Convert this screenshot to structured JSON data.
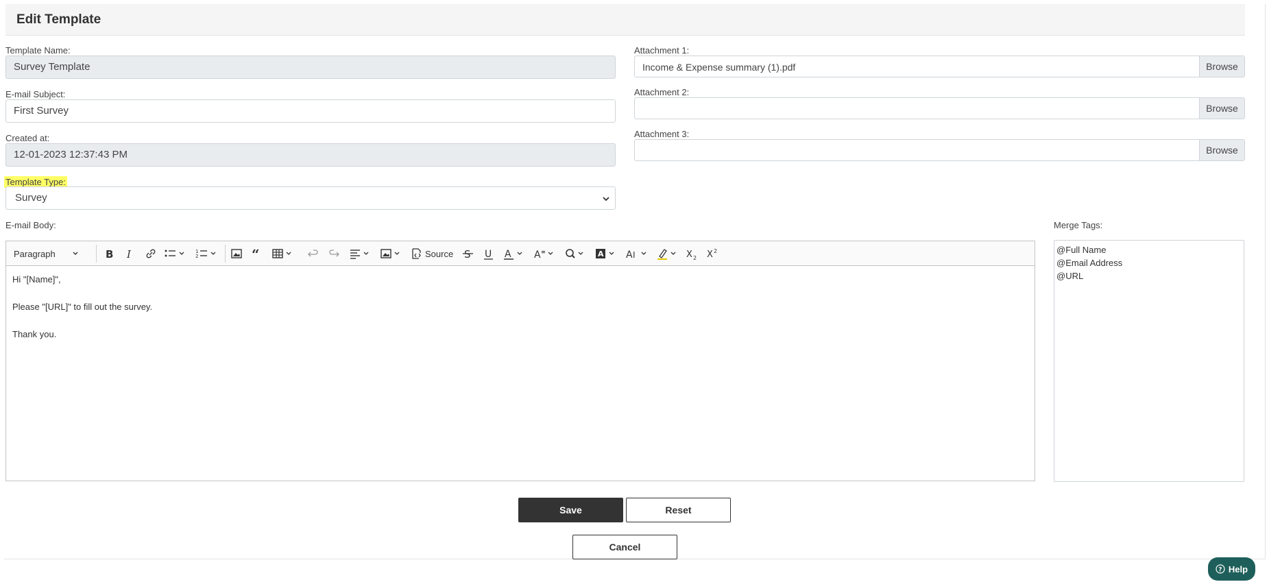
{
  "page": {
    "title": "Edit Template"
  },
  "form": {
    "template_name": {
      "label": "Template Name:",
      "value": "Survey Template"
    },
    "email_subject": {
      "label": "E-mail Subject:",
      "value": "First Survey"
    },
    "created_at": {
      "label": "Created at:",
      "value": "12-01-2023 12:37:43 PM"
    },
    "template_type": {
      "label": "Template Type:",
      "value": "Survey"
    },
    "email_body": {
      "label": "E-mail Body:"
    },
    "attachments": [
      {
        "label": "Attachment 1:",
        "file": "Income & Expense summary (1).pdf",
        "browse": "Browse"
      },
      {
        "label": "Attachment 2:",
        "file": "",
        "browse": "Browse"
      },
      {
        "label": "Attachment 3:",
        "file": "",
        "browse": "Browse"
      }
    ]
  },
  "editor": {
    "toolbar": {
      "heading": "Paragraph",
      "source": "Source"
    },
    "content": [
      "Hi \"[Name]\",",
      "Please \"[URL]\" to fill out the survey.",
      "Thank you."
    ]
  },
  "merge_tags": {
    "label": "Merge Tags:",
    "items": [
      "@Full Name",
      "@Email Address",
      "@URL"
    ]
  },
  "buttons": {
    "save": "Save",
    "reset": "Reset",
    "cancel": "Cancel",
    "help": "Help"
  },
  "colors": {
    "highlight": "#ffff66",
    "primary_button": "#333333",
    "help_button": "#1f5f5b",
    "readonly_bg": "#e9ecef"
  }
}
